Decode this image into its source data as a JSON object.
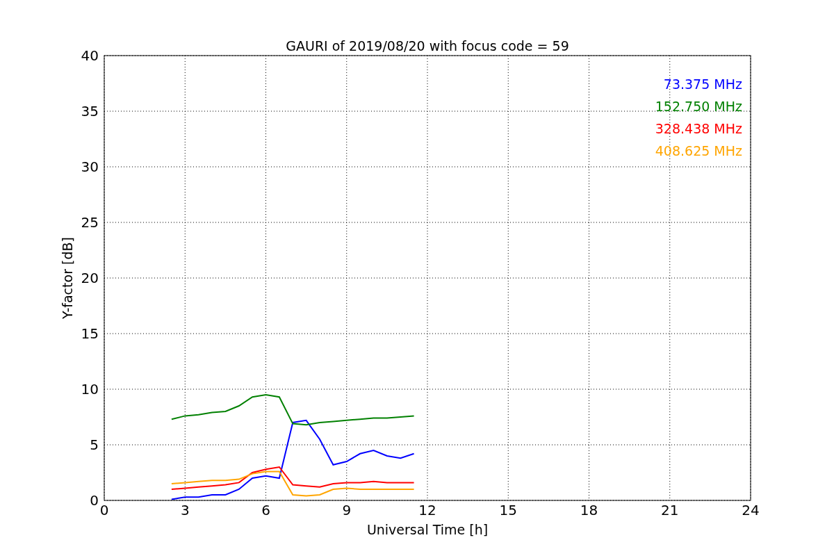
{
  "chart_data": {
    "type": "line",
    "title": "GAURI of 2019/08/20 with focus code = 59",
    "xlabel": "Universal Time [h]",
    "ylabel": "Y-factor [dB]",
    "x": [
      2.5,
      3,
      3.5,
      4,
      4.5,
      5,
      5.5,
      6,
      6.5,
      7,
      7.5,
      8,
      8.5,
      9,
      9.5,
      10,
      10.5,
      11,
      11.5
    ],
    "series": [
      {
        "name": "73.375 MHz",
        "color": "#0000ff",
        "values": [
          0.1,
          0.3,
          0.3,
          0.5,
          0.5,
          1.0,
          2.0,
          2.2,
          2.0,
          7.0,
          7.2,
          5.5,
          3.2,
          3.5,
          4.2,
          4.5,
          4.0,
          3.8,
          4.2
        ]
      },
      {
        "name": "152.750 MHz",
        "color": "#008000",
        "values": [
          7.3,
          7.6,
          7.7,
          7.9,
          8.0,
          8.5,
          9.3,
          9.5,
          9.3,
          6.9,
          6.8,
          7.0,
          7.1,
          7.2,
          7.3,
          7.4,
          7.4,
          7.5,
          7.6
        ]
      },
      {
        "name": "328.438 MHz",
        "color": "#ff0000",
        "values": [
          1.0,
          1.1,
          1.2,
          1.3,
          1.4,
          1.6,
          2.5,
          2.8,
          3.0,
          1.4,
          1.3,
          1.2,
          1.5,
          1.6,
          1.6,
          1.7,
          1.6,
          1.6,
          1.6
        ]
      },
      {
        "name": "408.625 MHz",
        "color": "#ffa500",
        "values": [
          1.5,
          1.6,
          1.7,
          1.8,
          1.8,
          1.9,
          2.4,
          2.6,
          2.6,
          0.5,
          0.4,
          0.5,
          1.0,
          1.1,
          1.0,
          1.0,
          1.0,
          1.0,
          1.0
        ]
      }
    ],
    "xlim": [
      0,
      24
    ],
    "ylim": [
      0,
      40
    ],
    "xticks": [
      0,
      3,
      6,
      9,
      12,
      15,
      18,
      21,
      24
    ],
    "yticks": [
      0,
      5,
      10,
      15,
      20,
      25,
      30,
      35,
      40
    ],
    "grid": true
  }
}
